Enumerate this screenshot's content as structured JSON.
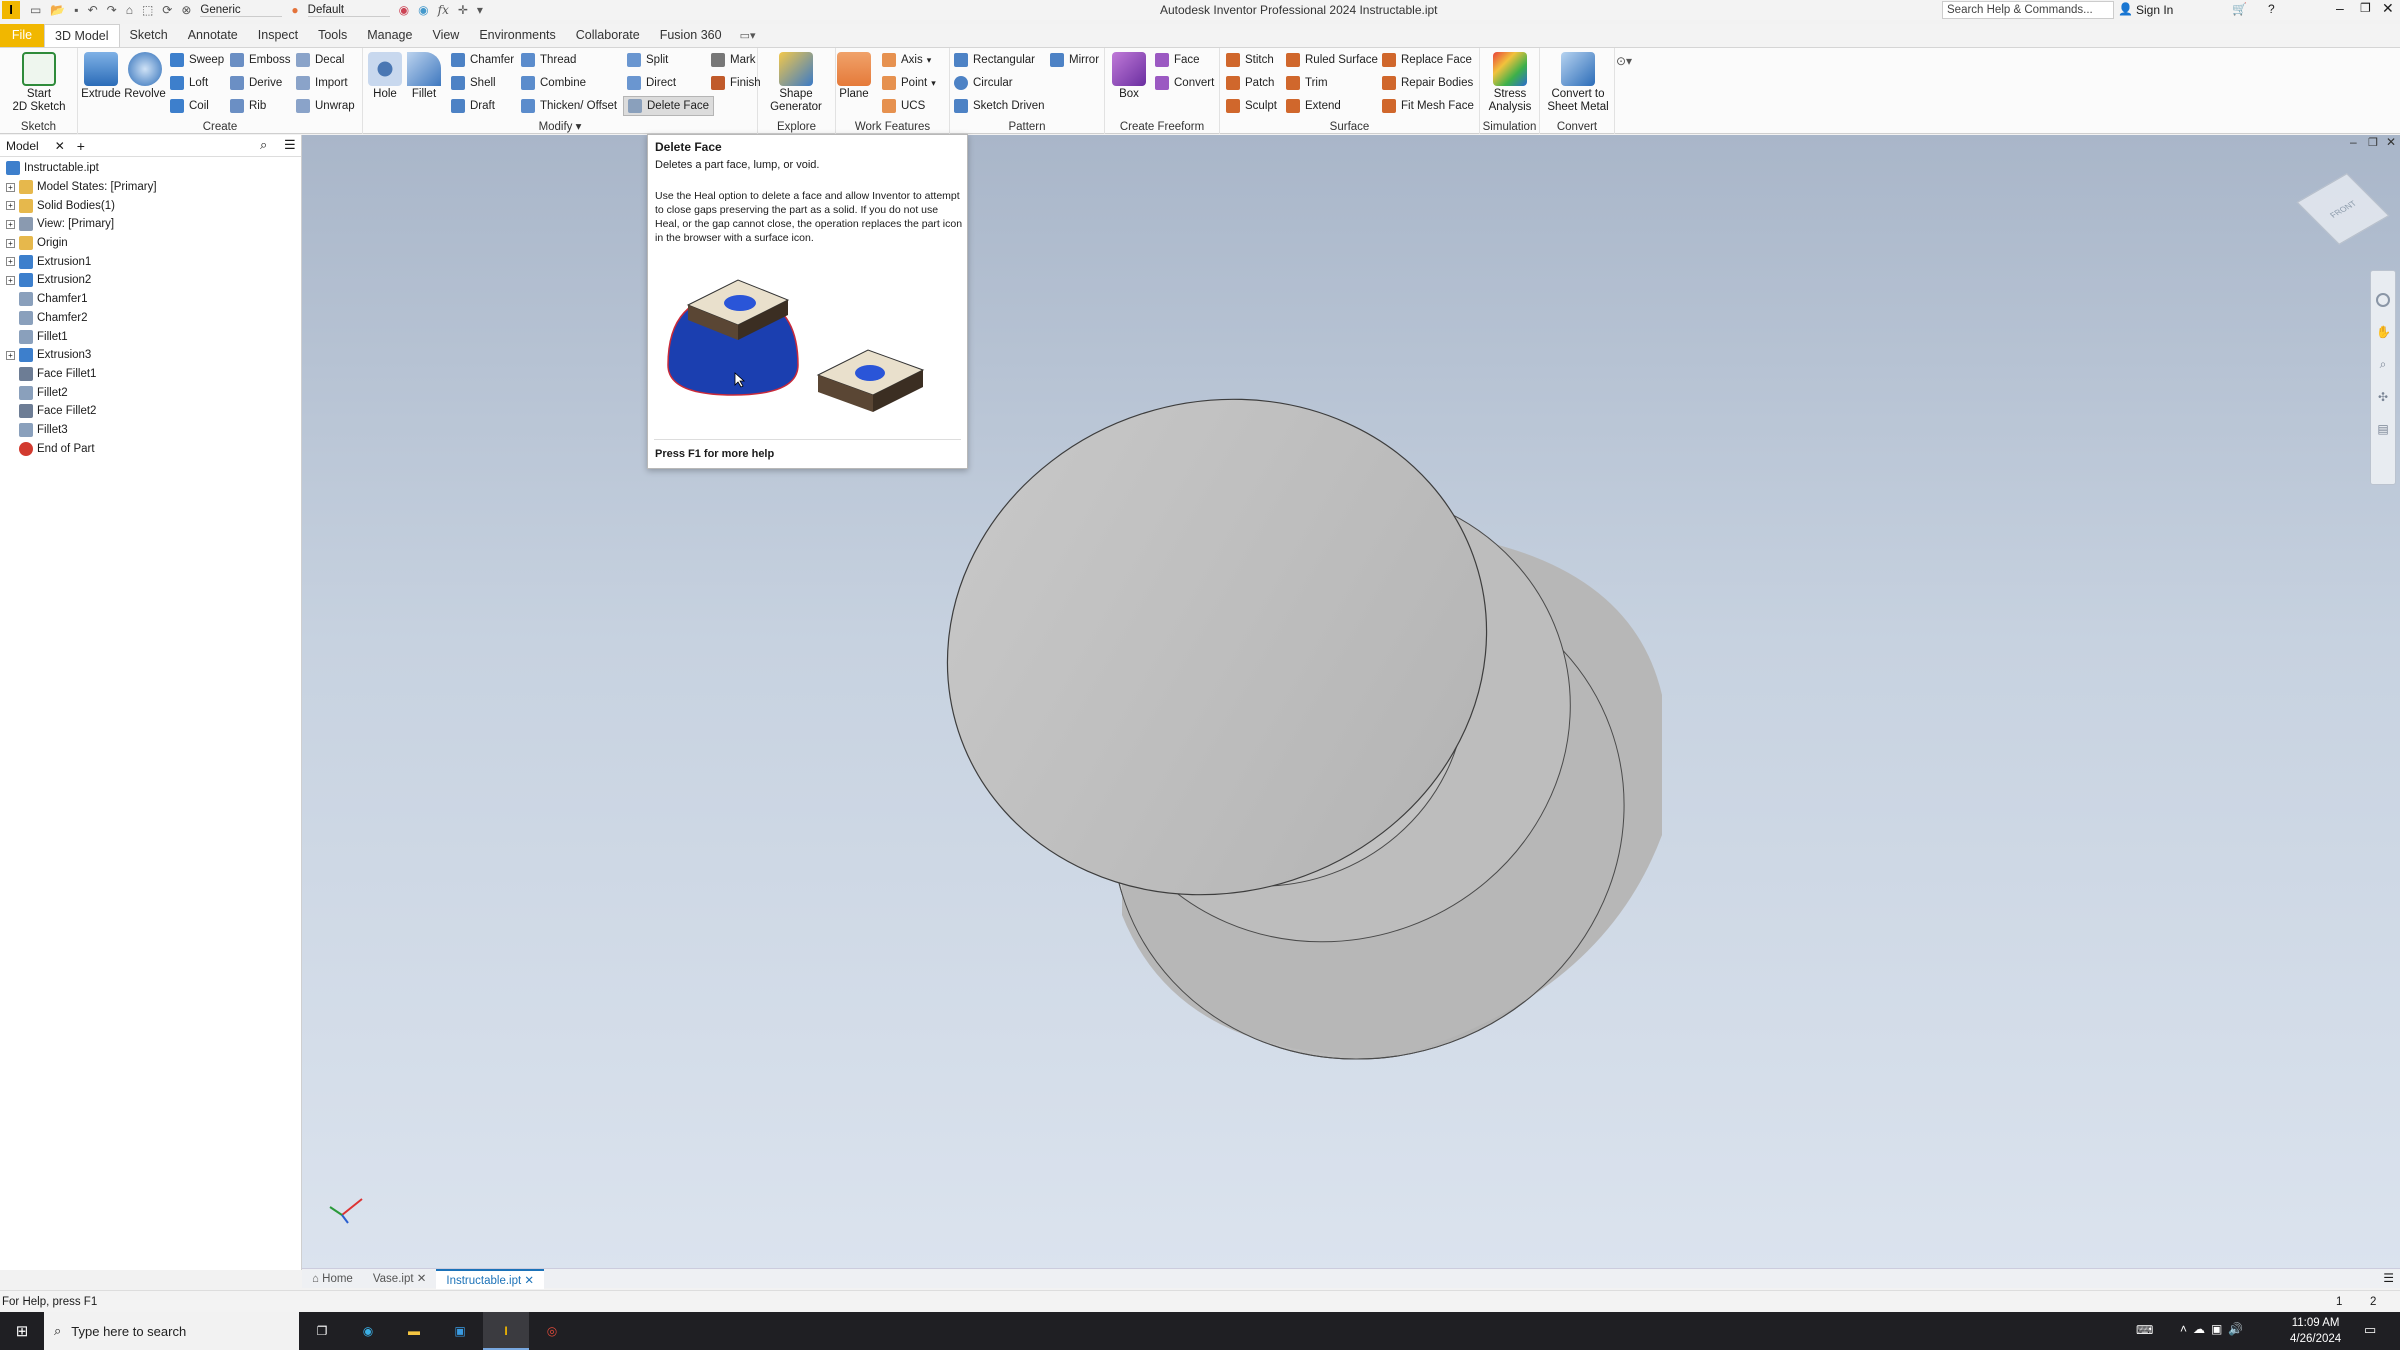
{
  "window": {
    "title": "Autodesk Inventor Professional 2024    Instructable.ipt"
  },
  "qat": {
    "appearance_value": "Generic",
    "material_value": "Default",
    "fx_label": "fx"
  },
  "search": {
    "placeholder": "Search Help & Commands..."
  },
  "account": {
    "sign_in_label": "Sign In"
  },
  "ribbon_tabs": [
    {
      "label": "File"
    },
    {
      "label": "3D Model"
    },
    {
      "label": "Sketch"
    },
    {
      "label": "Annotate"
    },
    {
      "label": "Inspect"
    },
    {
      "label": "Tools"
    },
    {
      "label": "Manage"
    },
    {
      "label": "View"
    },
    {
      "label": "Environments"
    },
    {
      "label": "Collaborate"
    },
    {
      "label": "Fusion 360"
    }
  ],
  "panels": {
    "sketch": {
      "label": "Sketch",
      "start": "Start\n2D Sketch"
    },
    "create": {
      "label": "Create",
      "extrude": "Extrude",
      "revolve": "Revolve",
      "sweep": "Sweep",
      "loft": "Loft",
      "coil": "Coil",
      "emboss": "Emboss",
      "derive": "Derive",
      "rib": "Rib",
      "decal": "Decal",
      "import": "Import",
      "unwrap": "Unwrap"
    },
    "modify": {
      "label": "Modify",
      "hole": "Hole",
      "fillet": "Fillet",
      "chamfer": "Chamfer",
      "shell": "Shell",
      "draft": "Draft",
      "thread": "Thread",
      "combine": "Combine",
      "thicken": "Thicken/ Offset",
      "split": "Split",
      "direct": "Direct",
      "delete_face": "Delete Face",
      "mark": "Mark",
      "finish": "Finish"
    },
    "explore": {
      "label": "Explore",
      "shape": "Shape\nGenerator"
    },
    "work": {
      "label": "Work Features",
      "plane": "Plane",
      "axis": "Axis",
      "point": "Point",
      "ucs": "UCS"
    },
    "pattern": {
      "label": "Pattern",
      "rect": "Rectangular",
      "circ": "Circular",
      "sketch_driven": "Sketch Driven",
      "mirror": "Mirror"
    },
    "freeform": {
      "label": "Create Freeform",
      "box": "Box",
      "face": "Face",
      "convert": "Convert"
    },
    "surface": {
      "label": "Surface",
      "stitch": "Stitch",
      "patch": "Patch",
      "sculpt": "Sculpt",
      "ruled": "Ruled Surface",
      "trim": "Trim",
      "extend": "Extend",
      "replace": "Replace Face",
      "repair": "Repair Bodies",
      "fitmesh": "Fit Mesh Face"
    },
    "simulation": {
      "label": "Simulation",
      "stress": "Stress\nAnalysis"
    },
    "convert": {
      "label": "Convert",
      "sheet": "Convert to\nSheet Metal"
    }
  },
  "browser": {
    "tab": "Model",
    "nodes": [
      {
        "label": "Instructable.ipt",
        "icon": "part"
      },
      {
        "label": "Model States: [Primary]",
        "icon": "folder",
        "exp": true
      },
      {
        "label": "Solid Bodies(1)",
        "icon": "folder",
        "exp": true
      },
      {
        "label": "View: [Primary]",
        "icon": "view",
        "exp": true
      },
      {
        "label": "Origin",
        "icon": "folder",
        "exp": true
      },
      {
        "label": "Extrusion1",
        "icon": "extrude",
        "exp": true
      },
      {
        "label": "Extrusion2",
        "icon": "extrude",
        "exp": true
      },
      {
        "label": "Chamfer1",
        "icon": "chamfer"
      },
      {
        "label": "Chamfer2",
        "icon": "chamfer"
      },
      {
        "label": "Fillet1",
        "icon": "fillet"
      },
      {
        "label": "Extrusion3",
        "icon": "extrude",
        "exp": true
      },
      {
        "label": "Face Fillet1",
        "icon": "facefillet"
      },
      {
        "label": "Fillet2",
        "icon": "fillet"
      },
      {
        "label": "Face Fillet2",
        "icon": "facefillet"
      },
      {
        "label": "Fillet3",
        "icon": "fillet"
      },
      {
        "label": "End of Part",
        "icon": "eop"
      }
    ]
  },
  "tooltip": {
    "title": "Delete Face",
    "summary": "Deletes a part face, lump, or void.",
    "body": "Use the Heal option to delete a face and allow Inventor to attempt to close gaps preserving the part as a solid. If you do not use Heal, or the gap cannot close, the operation replaces the part icon in the browser with a surface icon.",
    "footer": "Press F1 for more help"
  },
  "viewcube": {
    "face": "FRONT"
  },
  "doc_tabs": [
    {
      "label": "Home"
    },
    {
      "label": "Vase.ipt"
    },
    {
      "label": "Instructable.ipt"
    }
  ],
  "status": {
    "text": "For Help, press F1",
    "page_a": "1",
    "page_b": "2"
  },
  "taskbar": {
    "search_placeholder": "Type here to search",
    "time": "11:09 AM",
    "date": "4/26/2024"
  }
}
